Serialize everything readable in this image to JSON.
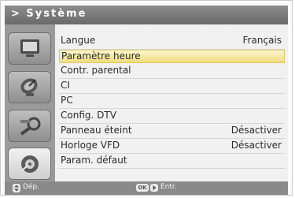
{
  "header": {
    "title": "> Système"
  },
  "sidebar": {
    "tiles": [
      {
        "icon": "tv-icon"
      },
      {
        "icon": "satellite-dish-icon"
      },
      {
        "icon": "tools-icon"
      },
      {
        "icon": "settings-disc-icon",
        "active": true
      }
    ]
  },
  "menu": {
    "items": [
      {
        "label": "Langue",
        "value": "Français"
      },
      {
        "label": "Paramètre heure",
        "value": ""
      },
      {
        "label": "Contr. parental",
        "value": ""
      },
      {
        "label": "CI",
        "value": ""
      },
      {
        "label": "PC",
        "value": ""
      },
      {
        "label": "Config. DTV",
        "value": ""
      },
      {
        "label": "Panneau éteint",
        "value": "Désactiver"
      },
      {
        "label": "Horloge VFD",
        "value": "Désactiver"
      },
      {
        "label": "Param. défaut",
        "value": ""
      }
    ],
    "selected_index": 1
  },
  "footer": {
    "move_label": "Dép.",
    "ok_key": "OK",
    "enter_label": "Entr."
  }
}
